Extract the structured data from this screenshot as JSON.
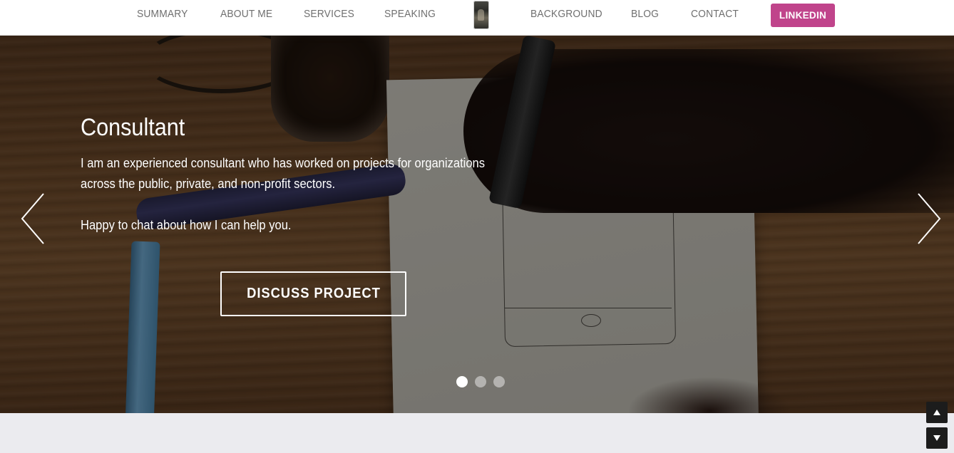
{
  "nav": {
    "items": [
      {
        "label": "SUMMARY"
      },
      {
        "label": "ABOUT ME"
      },
      {
        "label": "SERVICES"
      },
      {
        "label": "SPEAKING"
      },
      {
        "label": "BACKGROUND"
      },
      {
        "label": "BLOG"
      },
      {
        "label": "CONTACT"
      }
    ],
    "linkedin_label": "LINKEDIN",
    "linkedin_color": "#c0448b"
  },
  "hero": {
    "title": "Consultant",
    "paragraph_line_1": "I am an experienced consultant who has worked on projects for organizations",
    "paragraph_line_2": "across the public, private, and non-profit sectors.",
    "paragraph_2": "Happy to chat about how I can help you.",
    "cta_label": "DISCUSS PROJECT",
    "slides": {
      "count": 3,
      "active_index": 0
    }
  },
  "icons": {
    "prev": "chevron-left-icon",
    "next": "chevron-right-icon",
    "scroll_up": "triangle-up-icon",
    "scroll_down": "triangle-down-icon"
  }
}
